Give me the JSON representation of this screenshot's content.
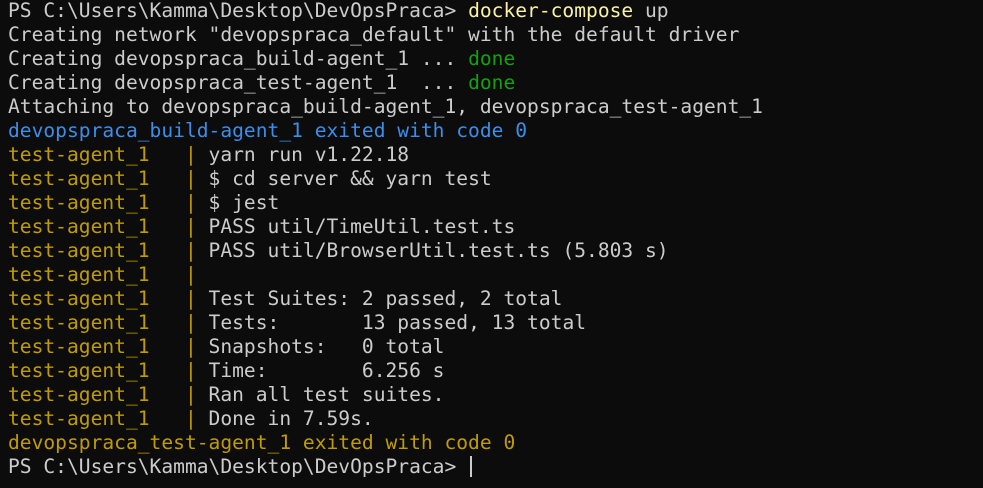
{
  "terminal": {
    "lines": [
      {
        "segments": [
          {
            "text": "PS C:\\Users\\Kamma\\Desktop\\DevOpsPraca> ",
            "color": "default"
          },
          {
            "text": "docker-compose",
            "color": "yellow"
          },
          {
            "text": " up",
            "color": "default"
          }
        ]
      },
      {
        "segments": [
          {
            "text": "Creating network \"devopspraca_default\" with the default driver",
            "color": "default"
          }
        ]
      },
      {
        "segments": [
          {
            "text": "Creating devopspraca_build-agent_1 ... ",
            "color": "default"
          },
          {
            "text": "done",
            "color": "green"
          }
        ]
      },
      {
        "segments": [
          {
            "text": "Creating devopspraca_test-agent_1  ... ",
            "color": "default"
          },
          {
            "text": "done",
            "color": "green"
          }
        ]
      },
      {
        "segments": [
          {
            "text": "Attaching to devopspraca_build-agent_1, devopspraca_test-agent_1",
            "color": "default"
          }
        ]
      },
      {
        "segments": [
          {
            "text": "devopspraca_build-agent_1 exited with code 0",
            "color": "blue"
          }
        ]
      },
      {
        "segments": [
          {
            "text": "test-agent_1   | ",
            "color": "gold"
          },
          {
            "text": "yarn run v1.22.18",
            "color": "default"
          }
        ]
      },
      {
        "segments": [
          {
            "text": "test-agent_1   | ",
            "color": "gold"
          },
          {
            "text": "$ cd server && yarn test",
            "color": "default"
          }
        ]
      },
      {
        "segments": [
          {
            "text": "test-agent_1   | ",
            "color": "gold"
          },
          {
            "text": "$ jest",
            "color": "default"
          }
        ]
      },
      {
        "segments": [
          {
            "text": "test-agent_1   | ",
            "color": "gold"
          },
          {
            "text": "PASS util/TimeUtil.test.ts",
            "color": "default"
          }
        ]
      },
      {
        "segments": [
          {
            "text": "test-agent_1   | ",
            "color": "gold"
          },
          {
            "text": "PASS util/BrowserUtil.test.ts (5.803 s)",
            "color": "default"
          }
        ]
      },
      {
        "segments": [
          {
            "text": "test-agent_1   | ",
            "color": "gold"
          }
        ]
      },
      {
        "segments": [
          {
            "text": "test-agent_1   | ",
            "color": "gold"
          },
          {
            "text": "Test Suites: 2 passed, 2 total",
            "color": "default"
          }
        ]
      },
      {
        "segments": [
          {
            "text": "test-agent_1   | ",
            "color": "gold"
          },
          {
            "text": "Tests:       13 passed, 13 total",
            "color": "default"
          }
        ]
      },
      {
        "segments": [
          {
            "text": "test-agent_1   | ",
            "color": "gold"
          },
          {
            "text": "Snapshots:   0 total",
            "color": "default"
          }
        ]
      },
      {
        "segments": [
          {
            "text": "test-agent_1   | ",
            "color": "gold"
          },
          {
            "text": "Time:        6.256 s",
            "color": "default"
          }
        ]
      },
      {
        "segments": [
          {
            "text": "test-agent_1   | ",
            "color": "gold"
          },
          {
            "text": "Ran all test suites.",
            "color": "default"
          }
        ]
      },
      {
        "segments": [
          {
            "text": "test-agent_1   | ",
            "color": "gold"
          },
          {
            "text": "Done in 7.59s.",
            "color": "default"
          }
        ]
      },
      {
        "segments": [
          {
            "text": "devopspraca_test-agent_1 exited with code 0",
            "color": "gold"
          }
        ]
      },
      {
        "segments": [
          {
            "text": "PS C:\\Users\\Kamma\\Desktop\\DevOpsPraca> ",
            "color": "default"
          }
        ],
        "cursor": true
      }
    ]
  },
  "colors": {
    "background": "#0c0c0c",
    "default": "#cccccc",
    "yellow": "#f9f1a5",
    "green": "#13a10e",
    "blue": "#3b8eea",
    "gold": "#c19c00"
  }
}
